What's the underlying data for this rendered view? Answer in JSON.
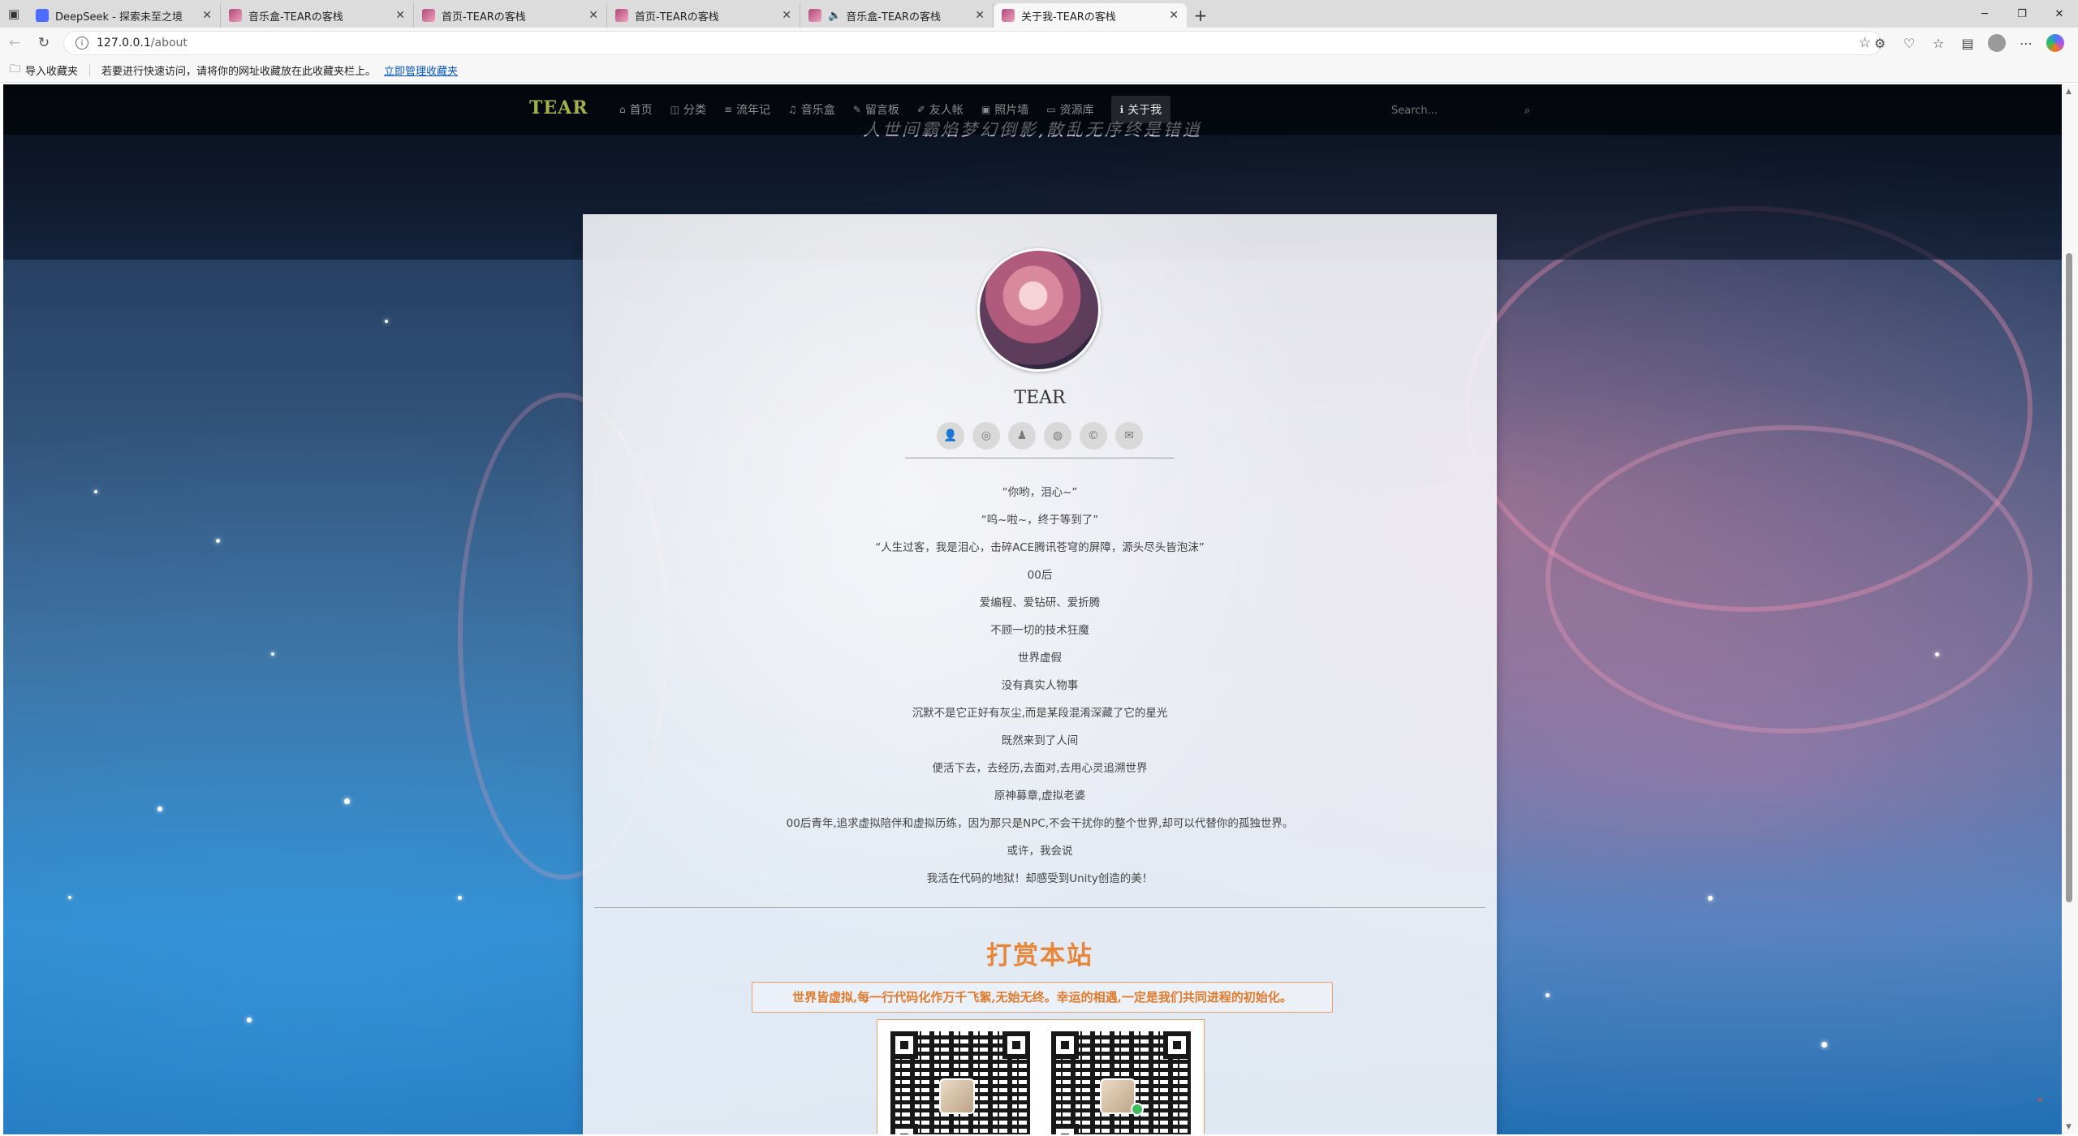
{
  "browser": {
    "tabs": [
      {
        "title": "DeepSeek - 探索未至之境",
        "favicon": "deepseek-icon",
        "active": false
      },
      {
        "title": "音乐盒-TEARの客栈",
        "favicon": "site-icon",
        "active": false
      },
      {
        "title": "首页-TEARの客栈",
        "favicon": "site-icon",
        "active": false
      },
      {
        "title": "首页-TEARの客栈",
        "favicon": "site-icon",
        "active": false
      },
      {
        "title": "音乐盒-TEARの客栈",
        "favicon": "site-icon",
        "active": false,
        "audio": true
      },
      {
        "title": "关于我-TEARの客栈",
        "favicon": "site-icon",
        "active": true
      }
    ],
    "url_host": "127.0.0.1",
    "url_path": "/about",
    "favorites_bar": {
      "import_label": "导入收藏夹",
      "hint": "若要进行快速访问，请将你的网址收藏放在此收藏夹栏上。",
      "manage_link": "立即管理收藏夹"
    }
  },
  "site": {
    "brand": "TEAR",
    "nav": [
      {
        "label": "首页",
        "icon": "home-icon"
      },
      {
        "label": "分类",
        "icon": "category-icon"
      },
      {
        "label": "流年记",
        "icon": "list-icon"
      },
      {
        "label": "音乐盒",
        "icon": "music-icon"
      },
      {
        "label": "留言板",
        "icon": "message-icon"
      },
      {
        "label": "友人帐",
        "icon": "pen-icon"
      },
      {
        "label": "照片墙",
        "icon": "image-icon"
      },
      {
        "label": "资源库",
        "icon": "folder-icon"
      },
      {
        "label": "关于我",
        "icon": "info-icon",
        "active": true
      }
    ],
    "search_placeholder": "Search...",
    "motto": "人世间霸焰梦幻倒影,散乱无序终是错逍"
  },
  "profile": {
    "name": "TEAR",
    "social_icons": [
      "user-icon",
      "wechat-icon",
      "qq-icon",
      "github-icon",
      "copyright-icon",
      "mail-icon"
    ],
    "lines": [
      "“你哟，泪心~”",
      "“呜~啦~，终于等到了”",
      "“人生过客，我是泪心，击碎ACE腾讯苍穹的屏障，源头尽头皆泡沫”",
      "00后",
      "爱编程、爱钻研、爱折腾",
      "不顾一切的技术狂魔",
      "世界虚假",
      "没有真实人物事",
      "沉默不是它正好有灰尘,而是某段混淆深藏了它的星光",
      "既然来到了人间",
      "便活下去，去经历,去面对,去用心灵追溯世界",
      "原神募章,虚拟老婆",
      "00后青年,追求虚拟陪伴和虚拟历练，因为那只是NPC,不会干扰你的整个世界,却可以代替你的孤独世界。",
      "或许，我会说",
      "我活在代码的地狱！却感受到Unity创造的美！"
    ]
  },
  "reward": {
    "title": "打赏本站",
    "quote": "世界皆虚拟,每一行代码化作万千飞絮,无始无终。幸运的相遇,一定是我们共同进程的初始化。"
  },
  "colors": {
    "accent": "#e8863a",
    "brand": "#a4b04a"
  }
}
